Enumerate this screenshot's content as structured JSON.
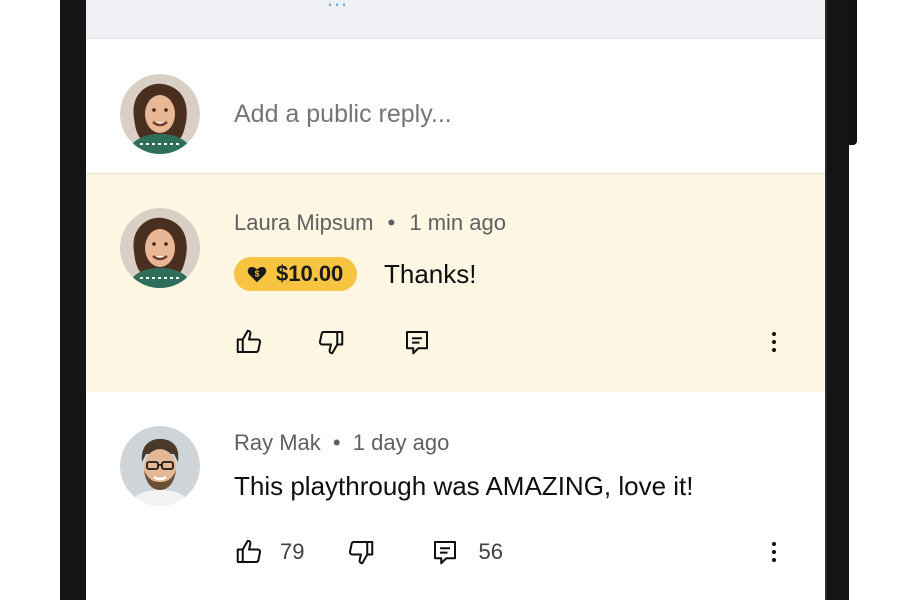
{
  "top_strip": {
    "faded_text": "…"
  },
  "reply_box": {
    "placeholder": "Add a public reply..."
  },
  "comments": [
    {
      "author": "Laura Mipsum",
      "time": "1 min ago",
      "super_chat": {
        "amount": "$10.00",
        "icon": "heart-dollar-icon",
        "color": "#f6c440"
      },
      "text": "Thanks!",
      "likes": "",
      "replies": ""
    },
    {
      "author": "Ray Mak",
      "time": "1 day ago",
      "text": "This playthrough was AMAZING, love it!",
      "likes": "79",
      "replies": "56"
    }
  ],
  "colors": {
    "highlight_bg": "#fdf6e3",
    "accent_gold": "#f6c440",
    "meta_gray": "#606060"
  }
}
